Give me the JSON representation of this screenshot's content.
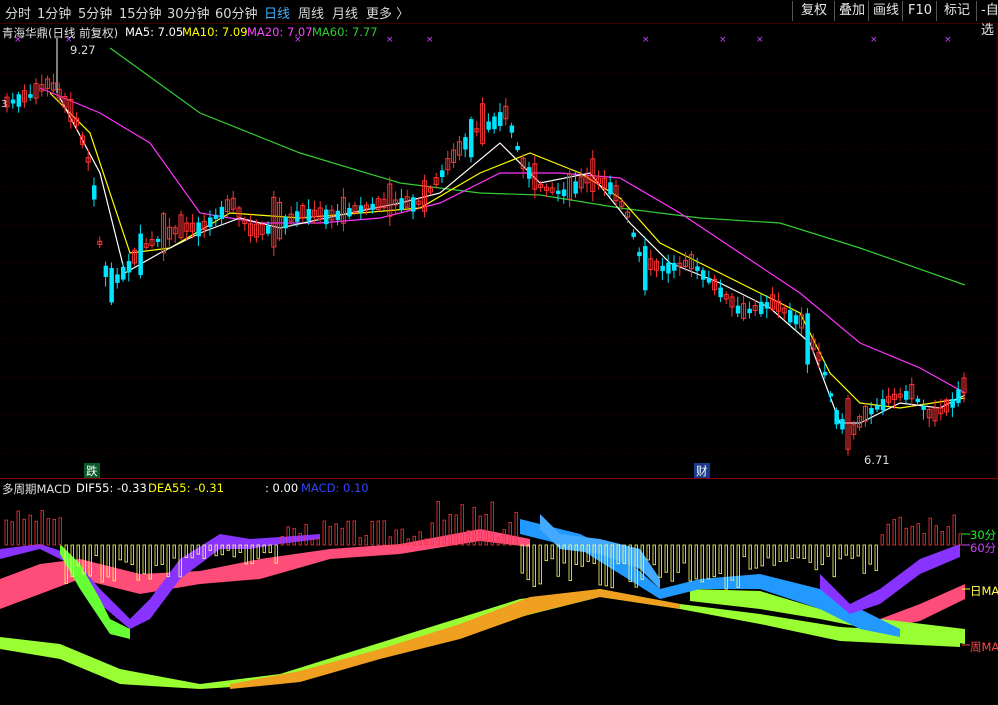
{
  "topbar": {
    "tabs": [
      {
        "label": "分时",
        "name": "tab-timeshare"
      },
      {
        "label": "1分钟",
        "name": "tab-1min"
      },
      {
        "label": "5分钟",
        "name": "tab-5min"
      },
      {
        "label": "15分钟",
        "name": "tab-15min"
      },
      {
        "label": "30分钟",
        "name": "tab-30min"
      },
      {
        "label": "60分钟",
        "name": "tab-60min"
      },
      {
        "label": "日线",
        "name": "tab-daily"
      },
      {
        "label": "周线",
        "name": "tab-weekly"
      },
      {
        "label": "月线",
        "name": "tab-monthly"
      },
      {
        "label": "更多 〉",
        "name": "tab-more"
      }
    ],
    "active_tab": "日线",
    "right_buttons": [
      {
        "label": "复权",
        "name": "adjust-button"
      },
      {
        "label": "叠加",
        "name": "overlay-button"
      },
      {
        "label": "画线",
        "name": "draw-line-button"
      },
      {
        "label": "F10",
        "name": "f10-button"
      },
      {
        "label": "标记",
        "name": "mark-button"
      },
      {
        "label": "-自选",
        "name": "watchlist-button"
      }
    ]
  },
  "main_chart": {
    "stock_title": "青海华鼎(日线 前复权)",
    "ma": [
      {
        "label": "MA5: 7.05",
        "color": "#ffffff"
      },
      {
        "label": "MA10: 7.09",
        "color": "#ffff00"
      },
      {
        "label": "MA20: 7.07",
        "color": "#ff33ff"
      },
      {
        "label": "MA60: 7.77",
        "color": "#33cc33"
      }
    ],
    "high_marker": "9.27",
    "low_marker": "6.71",
    "left_edge_label": "3",
    "event_labels": [
      "跌",
      "财"
    ]
  },
  "sub_chart": {
    "indicator_name": "多周期MACD",
    "values": [
      {
        "label": "DIF55: -0.33",
        "color": "#ffffff"
      },
      {
        "label": "DEA55: -0.31",
        "color": "#ffff00"
      },
      {
        "label": ": 0.00",
        "color": "#ffffff"
      },
      {
        "label": "MACD: 0.10",
        "color": "#3344ff"
      }
    ],
    "right_labels": [
      {
        "label": "30分",
        "color": "#22ee22"
      },
      {
        "label": "60分",
        "color": "#cc44ff"
      },
      {
        "label": "日MA",
        "color": "#ffff44"
      },
      {
        "label": "周MA",
        "color": "#ff4444"
      }
    ]
  },
  "colors": {
    "up": "#ff3333",
    "down": "#00e5ff",
    "ma5": "#ffffff",
    "ma10": "#ffff00",
    "ma20": "#ff33ff",
    "ma60": "#33cc33"
  }
}
